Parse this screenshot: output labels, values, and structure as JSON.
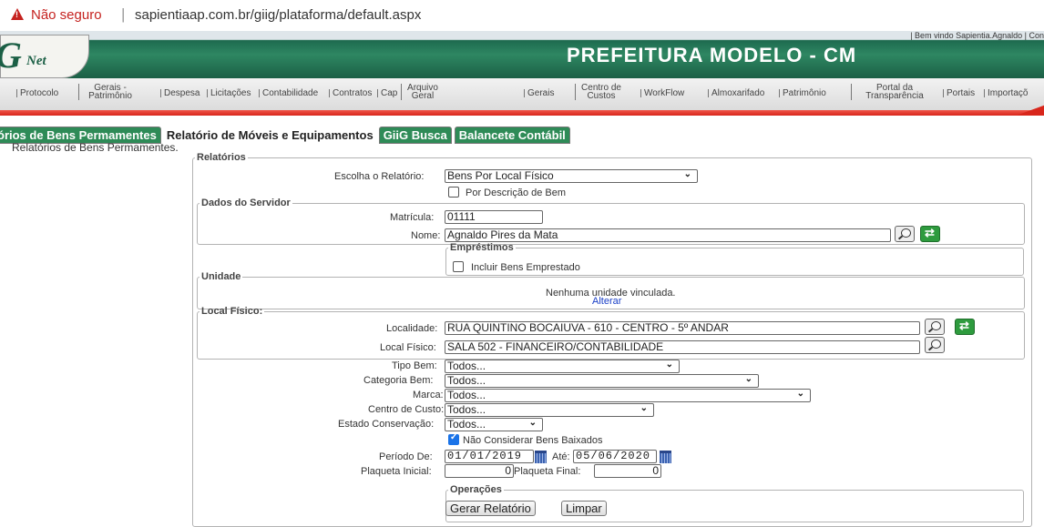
{
  "browser": {
    "security_label": "Não seguro",
    "url": "sapientiaap.com.br/giig/plataforma/default.aspx"
  },
  "header": {
    "welcome": "| Bem vindo Sapientia.Agnaldo | Con",
    "logo_g": "G",
    "logo_net": "Net",
    "title": "PREFEITURA MODELO - CM"
  },
  "menu": {
    "items": [
      "Protocolo",
      "Gerais - Patrimônio",
      "Despesa",
      "Licitações",
      "Contabilidade",
      "Contratos",
      "Cap",
      "Arquivo Geral",
      "Gerais",
      "Centro de Custos",
      "WorkFlow",
      "Almoxarifado",
      "Patrimônio",
      "Portal da Transparência",
      "Portais",
      "Importaçõ"
    ]
  },
  "tabs": [
    "órios de Bens Permamentes",
    "Relatório de Móveis e Equipamentos",
    "GiiG Busca",
    "Balancete Contábil"
  ],
  "subtitle": "Relatórios de Bens Permamentes.",
  "form": {
    "relatorios_legend": "Relatórios",
    "escolha_label": "Escolha o Relatório:",
    "escolha_value": "Bens Por Local Físico",
    "por_descricao_label": "Por Descrição de Bem",
    "servidor_legend": "Dados do Servidor",
    "matricula_label": "Matrícula:",
    "matricula_value": "01111",
    "nome_label": "Nome:",
    "nome_value": "Agnaldo Pires da Mata",
    "emprestimos_legend": "Empréstimos",
    "incluir_label": "Incluir Bens Emprestado",
    "unidade_legend": "Unidade",
    "unidade_text": "Nenhuma unidade vinculada.",
    "alterar_link": "Alterar",
    "local_legend": "Local Físico:",
    "localidade_label": "Localidade:",
    "localidade_value": "RUA QUINTINO BOCAIUVA - 610 - CENTRO - 5º ANDAR",
    "local_fisico_label": "Local Físico:",
    "local_fisico_value": "SALA 502 - FINANCEIRO/CONTABILIDADE",
    "tipo_bem_label": "Tipo Bem:",
    "tipo_bem_value": "Todos...",
    "categoria_label": "Categoria Bem:",
    "categoria_value": "Todos...",
    "marca_label": "Marca:",
    "marca_value": "Todos...",
    "centro_label": "Centro de Custo:",
    "centro_value": "Todos...",
    "estado_label": "Estado Conservação:",
    "estado_value": "Todos...",
    "nao_considerar_label": "Não Considerar Bens Baixados",
    "nao_considerar_checked": true,
    "periodo_label": "Período De:",
    "periodo_de": "01/01/2019",
    "ate_label": "Até:",
    "periodo_ate": "05/06/2020",
    "plaqueta_ini_label": "Plaqueta Inicial:",
    "plaqueta_ini_value": "0",
    "plaqueta_fim_label": "Plaqueta Final:",
    "plaqueta_fim_value": "0",
    "operacoes_legend": "Operações",
    "gerar_button": "Gerar Relatório",
    "limpar_button": "Limpar"
  },
  "colors": {
    "header_green": "#2e8762",
    "tab_green": "#2e8b57",
    "accent_red": "#d8261b",
    "link_blue": "#1a3fc7"
  }
}
